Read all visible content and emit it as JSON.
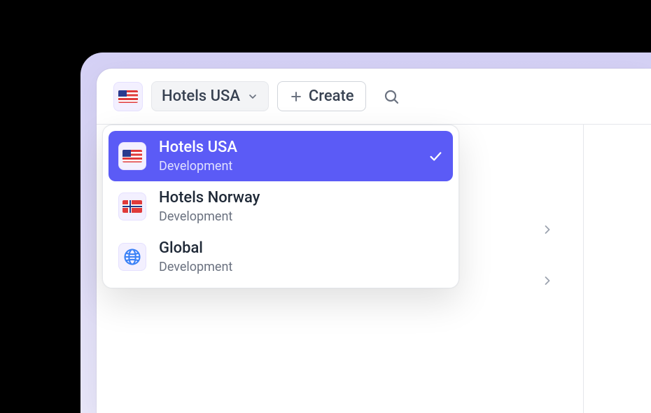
{
  "toolbar": {
    "selected_project": "Hotels USA",
    "create_label": "Create"
  },
  "dropdown": {
    "items": [
      {
        "title": "Hotels USA",
        "subtitle": "Development",
        "flag": "us",
        "selected": true
      },
      {
        "title": "Hotels Norway",
        "subtitle": "Development",
        "flag": "no",
        "selected": false
      },
      {
        "title": "Global",
        "subtitle": "Development",
        "flag": "globe",
        "selected": false
      }
    ]
  }
}
